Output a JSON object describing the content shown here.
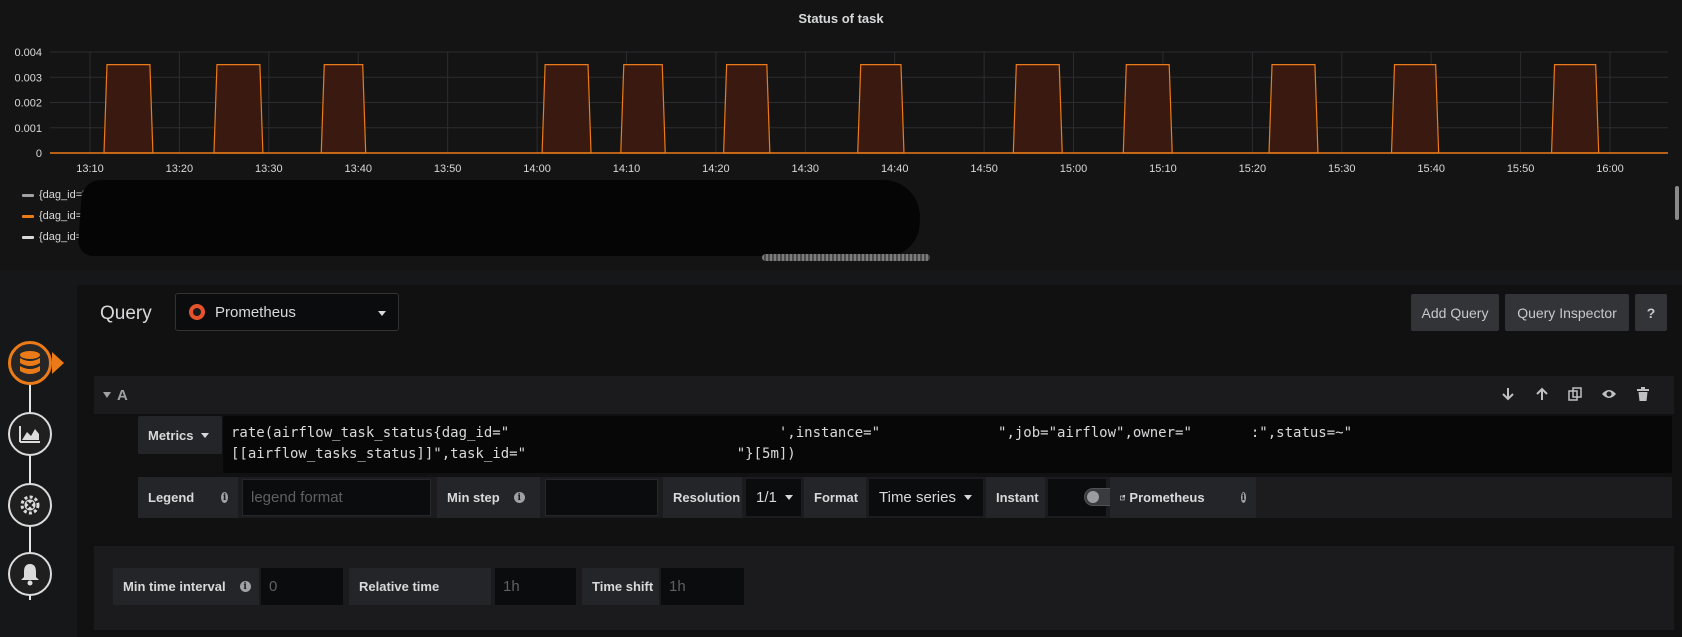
{
  "chart": {
    "title": "Status of task",
    "legend": [
      {
        "label": "{dag_id='",
        "color": "#9fa1a4"
      },
      {
        "label": "{dag_id='\"",
        "color": "#eb7b18"
      },
      {
        "label": "{dag_id='",
        "color": "#d8d9da"
      }
    ]
  },
  "chart_data": {
    "type": "area",
    "title": "Status of task",
    "x_ticks": [
      "13:10",
      "13:20",
      "13:30",
      "13:40",
      "13:50",
      "14:00",
      "14:10",
      "14:20",
      "14:30",
      "14:40",
      "14:50",
      "15:00",
      "15:10",
      "15:20",
      "15:30",
      "15:40",
      "15:50",
      "16:00"
    ],
    "y_ticks": [
      "0",
      "0.001",
      "0.002",
      "0.003",
      "0.004"
    ],
    "ylim": [
      0,
      0.004
    ],
    "xlim_minutes": [
      0,
      56
    ],
    "series": [
      {
        "color": "#eb7b18",
        "fill": "#3a1a10",
        "peak": 0.0035,
        "pulses_minutes": [
          [
            1.9,
            6.7
          ],
          [
            14.2,
            19.0
          ],
          [
            26.2,
            30.5
          ],
          [
            50.9,
            55.7
          ],
          [
            59.7,
            64.0
          ],
          [
            71.2,
            75.7
          ],
          [
            86.2,
            90.7
          ],
          [
            103.6,
            108.4
          ],
          [
            115.9,
            120.7
          ],
          [
            132.2,
            137.0
          ],
          [
            145.9,
            150.5
          ],
          [
            163.8,
            168.4
          ]
        ]
      }
    ]
  },
  "editor": {
    "query_label": "Query",
    "datasource": "Prometheus",
    "add_query": "Add Query",
    "query_inspector": "Query Inspector",
    "help": "?",
    "row_letter": "A",
    "metrics_label": "Metrics",
    "metrics_line1": "rate(airflow_task_status{dag_id=\"                                ',instance=\"              \",job=\"airflow\",owner=\"       :\",status=~\"",
    "metrics_line2": "[[airflow_tasks_status]]\",task_id=\"                         \"}[5m])",
    "legend_label": "Legend",
    "legend_placeholder": "legend format",
    "min_step_label": "Min step",
    "resolution_label": "Resolution",
    "resolution_value": "1/1",
    "format_label": "Format",
    "format_value": "Time series",
    "instant_label": "Instant",
    "datasource_link": "Prometheus",
    "min_interval_label": "Min time interval",
    "min_interval_placeholder": "0",
    "relative_time_label": "Relative time",
    "relative_time_placeholder": "1h",
    "time_shift_label": "Time shift",
    "time_shift_placeholder": "1h"
  },
  "icons": [
    "database-icon",
    "chart-icon",
    "gear-icon",
    "bell-icon",
    "arrow-down-icon",
    "arrow-up-icon",
    "copy-icon",
    "eye-icon",
    "trash-icon",
    "info-icon",
    "external-link-icon",
    "prometheus-icon"
  ]
}
